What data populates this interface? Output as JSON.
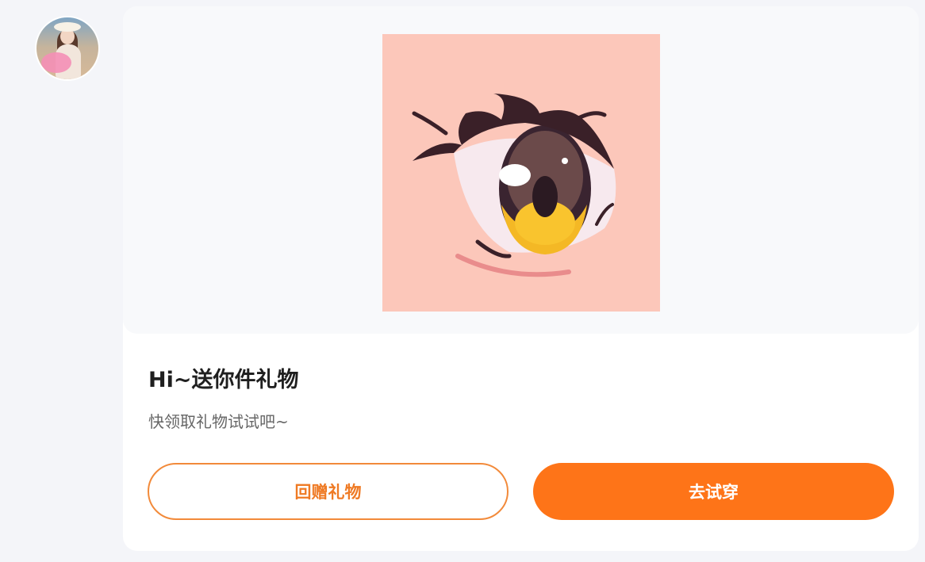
{
  "sender": {
    "avatar_icon": "user-avatar-icon"
  },
  "gift": {
    "image_icon": "anime-eye-icon",
    "title": "Hi~送你件礼物",
    "subtitle": "快领取礼物试试吧~",
    "image_bg": "#fcc7ba"
  },
  "actions": {
    "return_gift_label": "回赠礼物",
    "try_on_label": "去试穿",
    "accent": "#fe7418"
  }
}
